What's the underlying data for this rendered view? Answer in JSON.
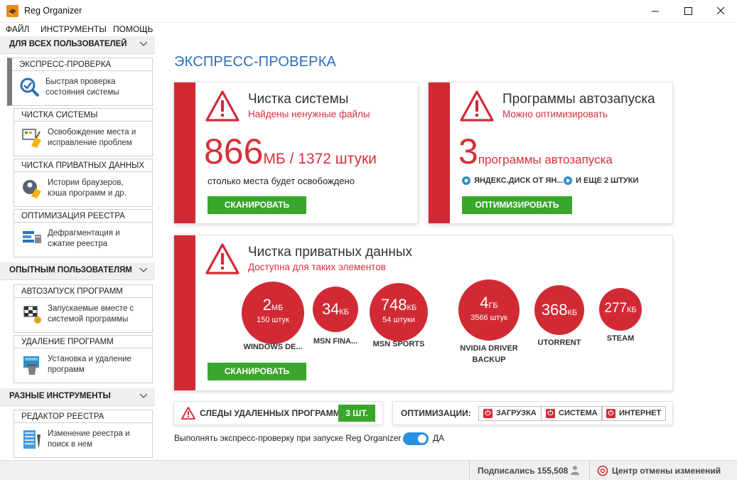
{
  "window": {
    "title": "Reg Organizer"
  },
  "menu": [
    "ФАЙЛ",
    "ИНСТРУМЕНТЫ",
    "ПОМОЩЬ"
  ],
  "sidebar": {
    "groups": [
      "ДЛЯ ВСЕХ ПОЛЬЗОВАТЕЛЕЙ",
      "ОПЫТНЫМ ПОЛЬЗОВАТЕЛЯМ",
      "РАЗНЫЕ ИНСТРУМЕНТЫ"
    ],
    "items": [
      {
        "title": "ЭКСПРЕСС-ПРОВЕРКА",
        "line1": "Быстрая проверка",
        "line2": "состояния системы"
      },
      {
        "title": "ЧИСТКА СИСТЕМЫ",
        "line1": "Освобождение места и",
        "line2": "исправление проблем"
      },
      {
        "title": "ЧИСТКА ПРИВАТНЫХ ДАННЫХ",
        "line1": "Истории браузеров,",
        "line2": "кэша программ и др."
      },
      {
        "title": "ОПТИМИЗАЦИЯ РЕЕСТРА",
        "line1": "Дефрагментация и",
        "line2": "сжатие реестра"
      },
      {
        "title": "АВТОЗАПУСК ПРОГРАММ",
        "line1": "Запускаемые вместе с",
        "line2": "системой программы"
      },
      {
        "title": "УДАЛЕНИЕ ПРОГРАММ",
        "line1": "Установка и удаление",
        "line2": "программ"
      },
      {
        "title": "РЕДАКТОР РЕЕСТРА",
        "line1": "Изменение реестра и",
        "line2": "поиск в нем"
      }
    ]
  },
  "main": {
    "page_title": "ЭКСПРЕСС-ПРОВЕРКА",
    "clean": {
      "title": "Чистка системы",
      "subtitle": "Найдены ненужные файлы",
      "big_value": "866",
      "big_suffix": "МБ / 1372 штуки",
      "note": "столько места будет освобождено",
      "button": "СКАНИРОВАТЬ"
    },
    "autorun": {
      "title": "Программы автозапуска",
      "subtitle": "Можно оптимизировать",
      "big_value": "3",
      "big_suffix": "программы автозапуска",
      "item1": "ЯНДЕКС.ДИСК ОТ ЯН...",
      "item2": "И ЕЩЕ 2 ШТУКИ",
      "button": "ОПТИМИЗИРОВАТЬ"
    },
    "private": {
      "title": "Чистка приватных данных",
      "subtitle": "Доступна для таких элементов",
      "button": "СКАНИРОВАТЬ",
      "circles": [
        {
          "value": "2",
          "unit": "МБ",
          "sub": "150 штук",
          "label": "WINDOWS DE..."
        },
        {
          "value": "34",
          "unit": "КБ",
          "sub": "",
          "label": "MSN FINA..."
        },
        {
          "value": "748",
          "unit": "КБ",
          "sub": "54 штуки",
          "label": "MSN SPORTS"
        },
        {
          "value": "4",
          "unit": "ГБ",
          "sub": "3566 штук",
          "label": "NVIDIA DRIVER BACKUP"
        },
        {
          "value": "368",
          "unit": "КБ",
          "sub": "",
          "label": "UTORRENT"
        },
        {
          "value": "277",
          "unit": "КБ",
          "sub": "",
          "label": "STEAM"
        }
      ]
    },
    "traces": {
      "label": "СЛЕДЫ УДАЛЕННЫХ ПРОГРАММ",
      "count": "3 ШТ."
    },
    "optim": {
      "label": "ОПТИМИЗАЦИИ:",
      "chips": [
        "ЗАГРУЗКА",
        "СИСТЕМА",
        "ИНТЕРНЕТ"
      ]
    },
    "toggle": {
      "text": "Выполнять экспресс-проверку при запуске Reg Organizer",
      "value": "ДА"
    }
  },
  "footer": {
    "subscribers": "Подписались 155,508",
    "undo_center": "Центр отмены изменений"
  },
  "colors": {
    "accent_red": "#d22a35",
    "green": "#3aa62c",
    "blue_title": "#2f6fb6"
  }
}
